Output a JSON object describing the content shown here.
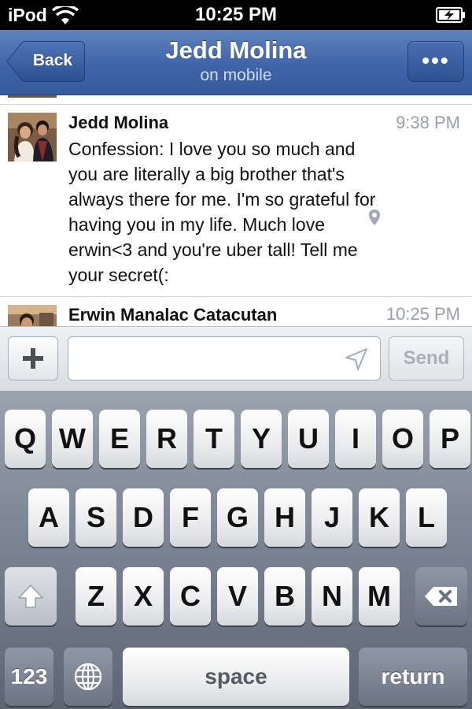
{
  "status_bar": {
    "carrier": "iPod",
    "time": "10:25 PM",
    "wifi_icon": "wifi-icon",
    "battery_icon": "battery-charging-icon"
  },
  "nav": {
    "back_label": "Back",
    "title": "Jedd Molina",
    "subtitle": "on mobile",
    "more_label": "•••"
  },
  "conversation": {
    "messages": [
      {
        "sender": "Jedd Molina",
        "time": "9:38 PM",
        "has_location": true,
        "lines": [
          "Confession: I love you so much and",
          "you are literally a big brother that's",
          "always there for me. I'm so grateful for",
          "having you in my life. Much love",
          "erwin<3 and you're uber tall! Tell me",
          "your secret(:"
        ]
      },
      {
        "sender": "Erwin Manalac Catacutan",
        "time": "10:25 PM",
        "has_location": false,
        "lines": []
      }
    ]
  },
  "compose": {
    "add_label": "+",
    "input_value": "",
    "input_placeholder": "",
    "send_label": "Send"
  },
  "keyboard": {
    "row1": [
      "Q",
      "W",
      "E",
      "R",
      "T",
      "Y",
      "U",
      "I",
      "O",
      "P"
    ],
    "row2": [
      "A",
      "S",
      "D",
      "F",
      "G",
      "H",
      "J",
      "K",
      "L"
    ],
    "row3": [
      "Z",
      "X",
      "C",
      "V",
      "B",
      "N",
      "M"
    ],
    "numbers_label": "123",
    "space_label": "space",
    "return_label": "return",
    "globe_icon": "globe-icon",
    "shift_icon": "shift-icon",
    "delete_icon": "backspace-icon"
  },
  "colors": {
    "nav_blue": "#3f64a8",
    "keyboard_bg": "#7c8593"
  }
}
